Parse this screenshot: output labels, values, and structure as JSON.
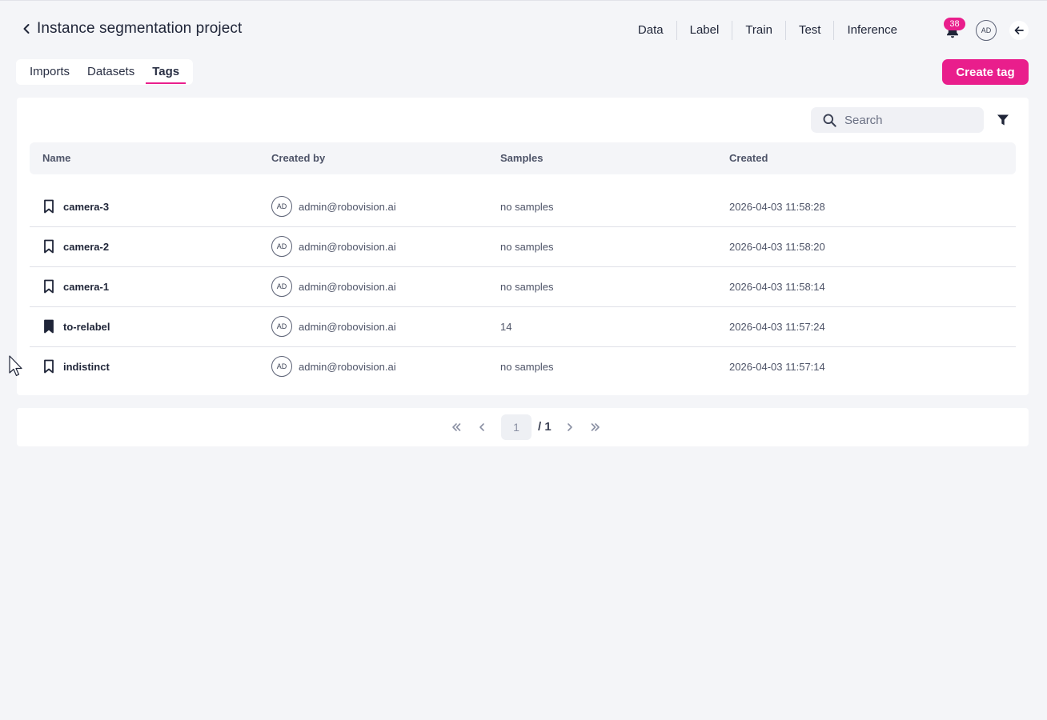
{
  "header": {
    "title": "Instance segmentation project",
    "nav": [
      "Data",
      "Label",
      "Train",
      "Test",
      "Inference"
    ],
    "notification_count": "38",
    "user_initials": "AD"
  },
  "tabs": [
    {
      "label": "Imports",
      "active": false
    },
    {
      "label": "Datasets",
      "active": false
    },
    {
      "label": "Tags",
      "active": true
    }
  ],
  "create_button_label": "Create tag",
  "search": {
    "placeholder": "Search"
  },
  "table": {
    "columns": [
      "Name",
      "Created by",
      "Samples",
      "Created"
    ],
    "rows": [
      {
        "name": "camera-3",
        "initials": "AD",
        "created_by": "admin@robovision.ai",
        "samples": "no samples",
        "created": "2026-04-03 11:58:28",
        "has_samples": false
      },
      {
        "name": "camera-2",
        "initials": "AD",
        "created_by": "admin@robovision.ai",
        "samples": "no samples",
        "created": "2026-04-03 11:58:20",
        "has_samples": false
      },
      {
        "name": "camera-1",
        "initials": "AD",
        "created_by": "admin@robovision.ai",
        "samples": "no samples",
        "created": "2026-04-03 11:58:14",
        "has_samples": false
      },
      {
        "name": "to-relabel",
        "initials": "AD",
        "created_by": "admin@robovision.ai",
        "samples": "14",
        "created": "2026-04-03 11:57:24",
        "has_samples": true
      },
      {
        "name": "indistinct",
        "initials": "AD",
        "created_by": "admin@robovision.ai",
        "samples": "no samples",
        "created": "2026-04-03 11:57:14",
        "has_samples": false
      }
    ]
  },
  "pagination": {
    "current": "1",
    "total": "/ 1"
  },
  "colors": {
    "accent": "#e91e8c",
    "text": "#1f2538",
    "background": "#f4f5f8"
  }
}
